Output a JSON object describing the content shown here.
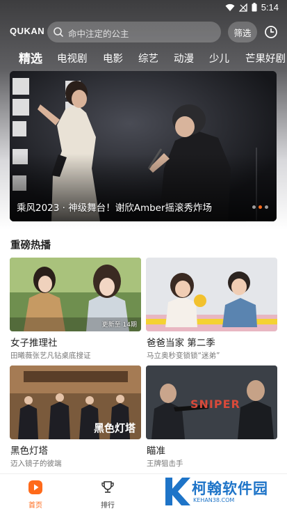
{
  "status_bar": {
    "time": "5:14"
  },
  "header": {
    "logo": "QUKAN",
    "search_placeholder": "命中注定的公主",
    "filter_label": "筛选"
  },
  "tabs": [
    {
      "label": "精选",
      "active": true
    },
    {
      "label": "电视剧"
    },
    {
      "label": "电影"
    },
    {
      "label": "综艺"
    },
    {
      "label": "动漫"
    },
    {
      "label": "少儿"
    },
    {
      "label": "芒果好剧"
    }
  ],
  "banner": {
    "caption": "乘风2023 · 神级舞台！谢欣Amber摇滚秀炸场",
    "dots_total": 3,
    "dots_active": 2
  },
  "section": {
    "title": "重磅热播"
  },
  "cards": [
    {
      "title": "女子推理社",
      "subtitle": "田曦薇张艺凡钻桌底搜证",
      "badge": "更新至 14期"
    },
    {
      "title": "爸爸当家 第二季",
      "subtitle": "马立奥秒变锁锁“迷弟”",
      "badge": ""
    },
    {
      "title": "黑色灯塔",
      "subtitle": "迈入镜子的彼端",
      "badge": "",
      "poster_text": "黑色灯塔"
    },
    {
      "title": "瞄准",
      "subtitle": "王牌狙击手",
      "badge": "",
      "poster_text": "SNIPER"
    }
  ],
  "bottom_nav": [
    {
      "label": "首页",
      "active": true
    },
    {
      "label": "排行",
      "active": false
    }
  ],
  "watermark": {
    "text": "柯翰软件园",
    "url": "KEHAN38.COM"
  },
  "colors": {
    "accent": "#ff6a1a",
    "watermark": "#1e74c8"
  }
}
